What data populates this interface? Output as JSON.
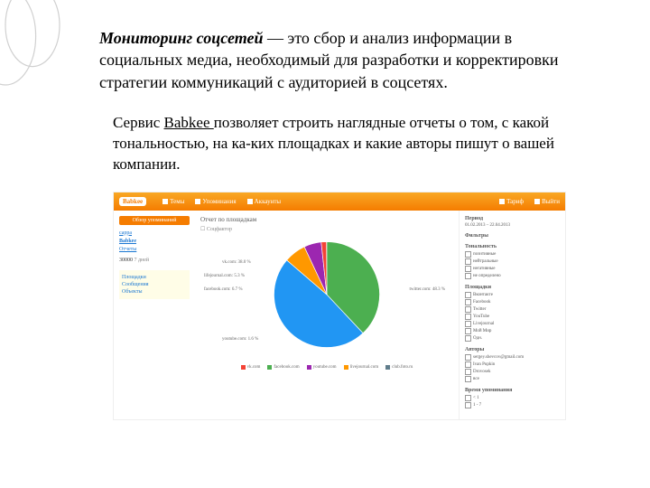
{
  "heading_bold": "Мониторинг соцсетей",
  "heading_rest": " — это сбор и анализ информации в социальных медиа, необходимый для разработки и корректировки стратегии коммуникаций с аудиторией в соцсетях.",
  "para_pre": "Сервис ",
  "para_link": "Babkee ",
  "para_post": "позволяет строить наглядные отчеты о том, с какой тональностью, на ка-ких площадках и какие авторы пишут о вашей компании.",
  "screenshot": {
    "logo": "Babkee",
    "nav": [
      "Темы",
      "Упоминания",
      "Аккаунты"
    ],
    "right": [
      "Тариф",
      "Выйти"
    ],
    "sidebar": {
      "button": "Обзор упоминаний",
      "items": [
        "cappa",
        "Babkee",
        "Отчеты"
      ],
      "count": "30000",
      "period": "7 дней",
      "reports": [
        "Площадки",
        "Сообщения",
        "Объекты"
      ]
    },
    "main": {
      "title": "Отчет по площадкам",
      "checkbox": "Соцфактор",
      "pie_labels": [
        "vk.com: 38.0 %",
        "lifejournal.com: 5.3 %",
        "facebook.com: 6.7 %",
        "youtube.com: 1.6 %",
        "twitter.com: 48.3 %"
      ],
      "legend": [
        "vk.com",
        "facebook.com",
        "youtube.com",
        "livejournal.com",
        "club.foto.ru"
      ]
    },
    "right_panel": {
      "period_h": "Период",
      "period_v": "01.02.2013 – 22.04.2013",
      "filters_h": "Фильтры",
      "ton_h": "Тональность",
      "ton": [
        "позитивные",
        "нейтральные",
        "негативные",
        "не определено"
      ],
      "plat_h": "Площадки",
      "plat": [
        "Вконтакте",
        "Facebook",
        "Twitter",
        "YouTube",
        "Livejournal",
        "Мой Мир",
        "Одн."
      ],
      "auth_h": "Авторы",
      "auth": [
        "sergey.shevcov@gmail.com",
        "Ivan Pupkin",
        "Drovosek",
        "все"
      ],
      "time_h": "Время упоминания",
      "time": [
        "< 1",
        "1 - 7"
      ]
    }
  },
  "chart_data": {
    "type": "pie",
    "title": "Отчет по площадкам",
    "series": [
      {
        "name": "vk.com",
        "value": 38.0,
        "color": "#4caf50"
      },
      {
        "name": "twitter.com",
        "value": 48.3,
        "color": "#2196f3"
      },
      {
        "name": "facebook.com",
        "value": 6.7,
        "color": "#ff9800"
      },
      {
        "name": "livejournal.com",
        "value": 5.3,
        "color": "#9c27b0"
      },
      {
        "name": "youtube.com",
        "value": 1.6,
        "color": "#f44336"
      }
    ]
  },
  "legend_colors": [
    "#f44336",
    "#4caf50",
    "#9c27b0",
    "#ff9800",
    "#607d8b"
  ]
}
